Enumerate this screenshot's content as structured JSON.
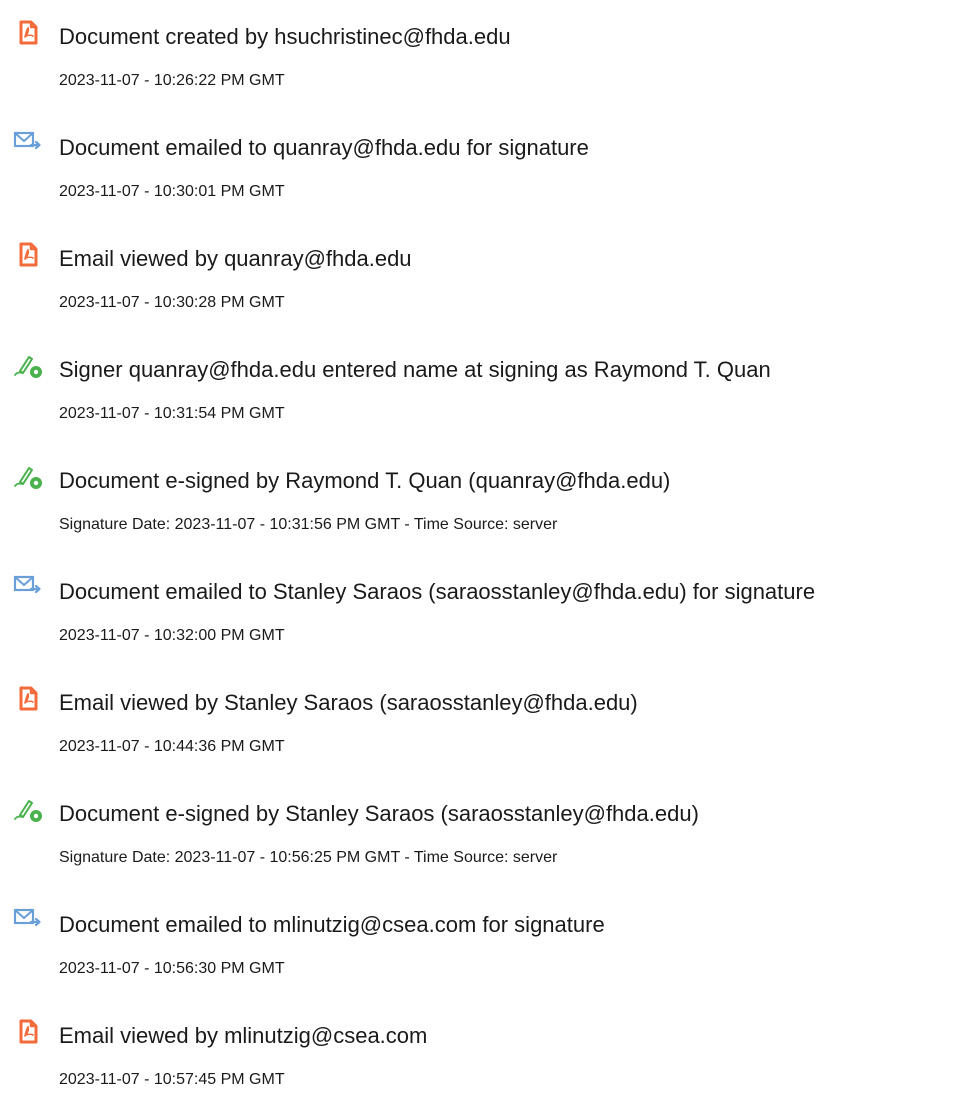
{
  "events": [
    {
      "icon": "document-created-icon",
      "title": "Document created by hsuchristinec@fhda.edu",
      "time": "2023-11-07 - 10:26:22 PM GMT"
    },
    {
      "icon": "email-sent-icon",
      "title": "Document emailed to quanray@fhda.edu for signature",
      "time": "2023-11-07 - 10:30:01 PM GMT"
    },
    {
      "icon": "email-viewed-icon",
      "title": "Email viewed by quanray@fhda.edu",
      "time": "2023-11-07 - 10:30:28 PM GMT"
    },
    {
      "icon": "signature-pen-icon",
      "title": "Signer quanray@fhda.edu entered name at signing as Raymond T. Quan",
      "time": "2023-11-07 - 10:31:54 PM GMT"
    },
    {
      "icon": "signature-pen-icon",
      "title": "Document e-signed by Raymond T. Quan (quanray@fhda.edu)",
      "time": "Signature Date: 2023-11-07 - 10:31:56 PM GMT - Time Source: server"
    },
    {
      "icon": "email-sent-icon",
      "title": "Document emailed to Stanley Saraos (saraosstanley@fhda.edu) for signature",
      "time": "2023-11-07 - 10:32:00 PM GMT"
    },
    {
      "icon": "email-viewed-icon",
      "title": "Email viewed by Stanley Saraos (saraosstanley@fhda.edu)",
      "time": "2023-11-07 - 10:44:36 PM GMT"
    },
    {
      "icon": "signature-pen-icon",
      "title": "Document e-signed by Stanley Saraos (saraosstanley@fhda.edu)",
      "time": "Signature Date: 2023-11-07 - 10:56:25 PM GMT - Time Source: server"
    },
    {
      "icon": "email-sent-icon",
      "title": "Document emailed to mlinutzig@csea.com for signature",
      "time": "2023-11-07 - 10:56:30 PM GMT"
    },
    {
      "icon": "email-viewed-icon",
      "title": "Email viewed by mlinutzig@csea.com",
      "time": "2023-11-07 - 10:57:45 PM GMT"
    }
  ],
  "colors": {
    "acrobat_red": "#f26b3a",
    "mail_blue": "#6a9fd8",
    "sign_green": "#49b24d",
    "text": "#1a1a1a"
  }
}
